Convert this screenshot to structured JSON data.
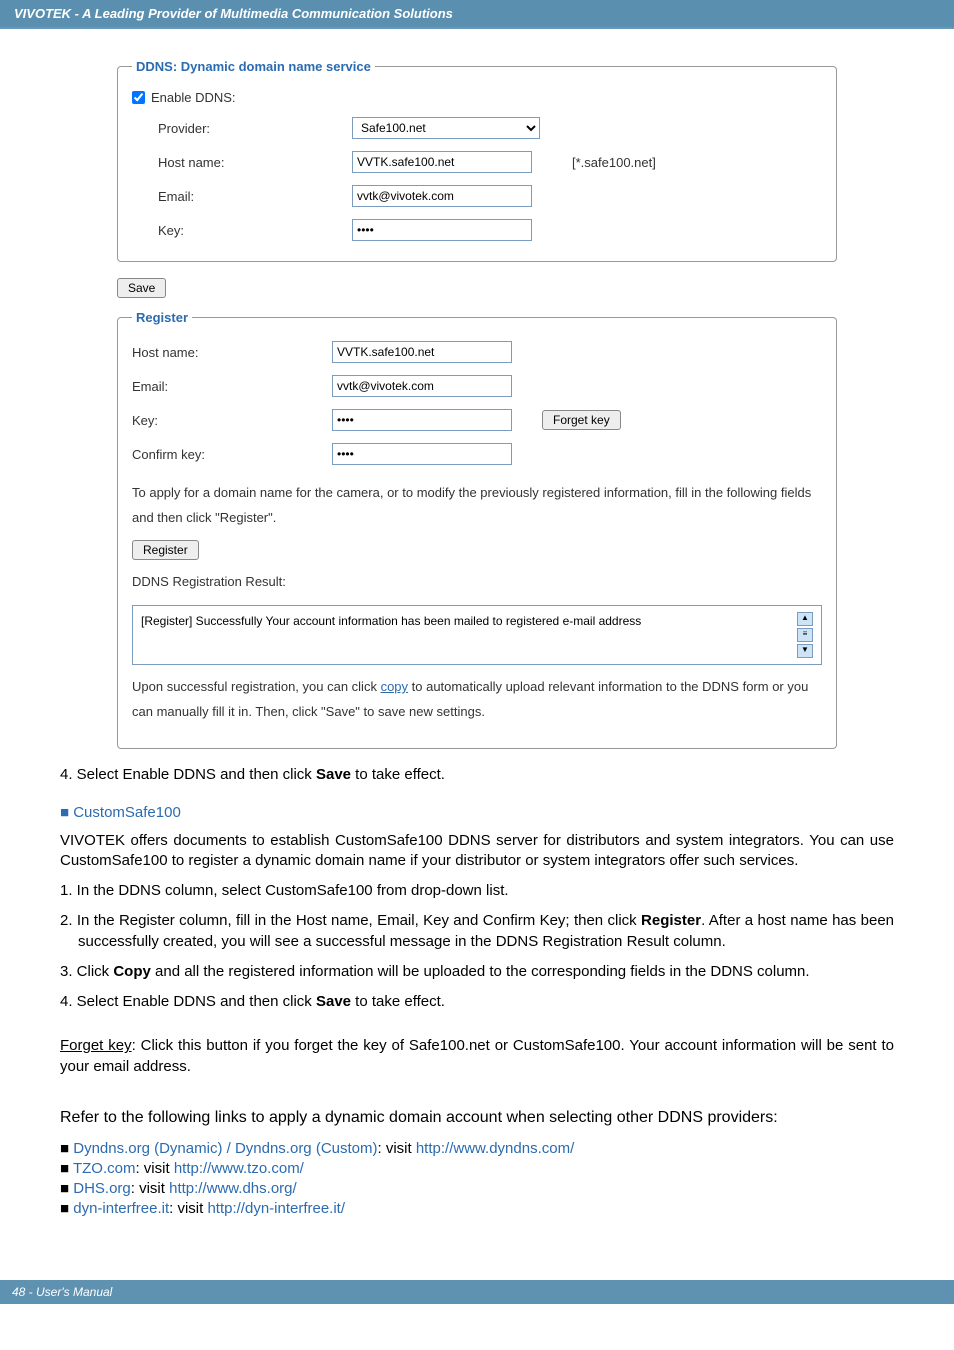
{
  "header": {
    "title": "VIVOTEK - A Leading Provider of Multimedia Communication Solutions"
  },
  "ddns_panel": {
    "legend": "DDNS: Dynamic domain name service",
    "enable_label": "Enable DDNS:",
    "provider_label": "Provider:",
    "provider_value": "Safe100.net",
    "hostname_label": "Host name:",
    "hostname_value": "VVTK.safe100.net",
    "hostname_suffix": "[*.safe100.net]",
    "email_label": "Email:",
    "email_value": "vvtk@vivotek.com",
    "key_label": "Key:",
    "key_value": "••••"
  },
  "save_button": "Save",
  "register_panel": {
    "legend": "Register",
    "hostname_label": "Host name:",
    "hostname_value": "VVTK.safe100.net",
    "email_label": "Email:",
    "email_value": "vvtk@vivotek.com",
    "key_label": "Key:",
    "key_value": "••••",
    "forget_button": "Forget key",
    "confirm_label": "Confirm key:",
    "confirm_value": "••••",
    "instruction": "To apply for a domain name for the camera, or to modify the previously registered information, fill in the following fields and then click \"Register\".",
    "register_button": "Register",
    "result_label": "DDNS Registration Result:",
    "result_text": "[Register] Successfully  Your account information has been mailed to registered e-mail address",
    "upon_text_a": "Upon successful registration, you can click ",
    "upon_copy": "copy",
    "upon_text_b": " to automatically upload relevant information to the DDNS form or you can manually fill it in. Then, click \"Save\" to save new settings."
  },
  "body": {
    "step4_top": "4. Select Enable DDNS and then click ",
    "step4_save": "Save",
    "step4_end": " to take effect.",
    "customsafe_head": "■ CustomSafe100",
    "customsafe_para": "VIVOTEK offers documents to establish CustomSafe100 DDNS server for distributors and system integrators. You can use CustomSafe100 to register a dynamic domain name if your distributor or system integrators offer such services.",
    "step1": "1. In the DDNS column, select CustomSafe100 from drop-down list.",
    "step2a": "2. In the Register column, fill in the Host name, Email, Key and Confirm Key; then click ",
    "step2_reg": "Register",
    "step2b": ". After a host name has been successfully created, you will see a successful message in the DDNS Registration Result column.",
    "step3a": "3. Click ",
    "step3_copy": "Copy",
    "step3b": " and all the registered information will be uploaded to the corresponding fields in the DDNS column.",
    "step4b_a": "4. Select Enable DDNS and then click ",
    "step4b_save": "Save",
    "step4b_b": " to take effect.",
    "forget_label": "Forget key",
    "forget_text": ": Click this button if you forget the key of Safe100.net or CustomSafe100. Your account information will be sent to your email address.",
    "refer_text": "Refer to the following links to apply a dynamic domain account when selecting other DDNS providers:",
    "providers": [
      {
        "name": "Dyndns.org (Dynamic) / Dyndns.org (Custom)",
        "visit": ": visit ",
        "url": "http://www.dyndns.com/"
      },
      {
        "name": "TZO.com",
        "visit": ": visit ",
        "url": "http://www.tzo.com/"
      },
      {
        "name": "DHS.org",
        "visit": ": visit ",
        "url": "http://www.dhs.org/"
      },
      {
        "name": "dyn-interfree.it",
        "visit": ": visit ",
        "url": "http://dyn-interfree.it/"
      }
    ]
  },
  "footer": {
    "text": "48 - User's Manual"
  }
}
